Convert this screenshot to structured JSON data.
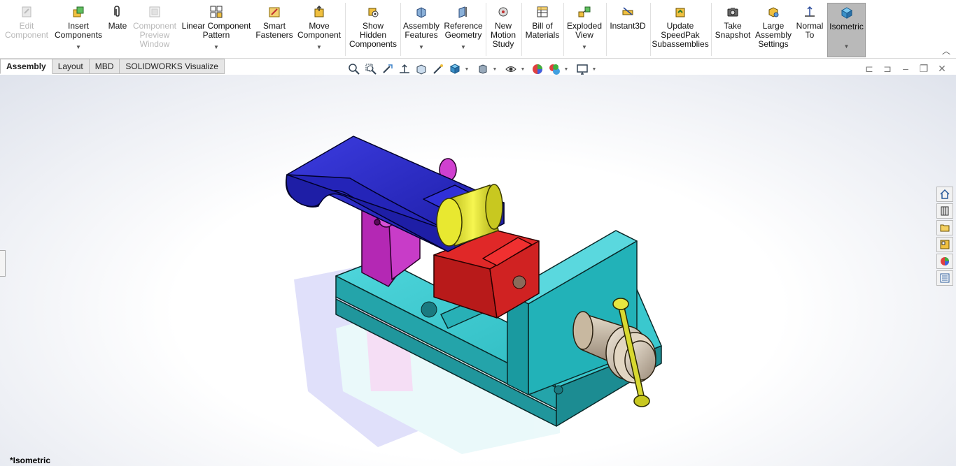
{
  "ribbon": {
    "buttons": [
      {
        "label": "Edit\nComponent",
        "icon": "edit-component-icon",
        "disabled": true
      },
      {
        "label": "Insert\nComponents",
        "icon": "insert-components-icon",
        "dropdown": true
      },
      {
        "label": "Mate",
        "icon": "mate-paperclip-icon"
      },
      {
        "label": "Component\nPreview\nWindow",
        "icon": "preview-window-icon",
        "disabled": true
      },
      {
        "label": "Linear Component\nPattern",
        "icon": "linear-pattern-icon",
        "dropdown": true
      },
      {
        "label": "Smart\nFasteners",
        "icon": "smart-fasteners-icon"
      },
      {
        "label": "Move\nComponent",
        "icon": "move-component-icon",
        "dropdown": true
      },
      {
        "label": "Show\nHidden\nComponents",
        "icon": "show-hidden-icon"
      },
      {
        "label": "Assembly\nFeatures",
        "icon": "assembly-features-icon",
        "dropdown": true
      },
      {
        "label": "Reference\nGeometry",
        "icon": "reference-geometry-icon",
        "dropdown": true
      },
      {
        "label": "New\nMotion\nStudy",
        "icon": "motion-study-icon"
      },
      {
        "label": "Bill of\nMaterials",
        "icon": "bill-of-materials-icon"
      },
      {
        "label": "Exploded\nView",
        "icon": "exploded-view-icon",
        "dropdown": true
      },
      {
        "label": "Instant3D",
        "icon": "instant3d-icon"
      },
      {
        "label": "Update\nSpeedPak\nSubassemblies",
        "icon": "speedpak-icon"
      },
      {
        "label": "Take\nSnapshot",
        "icon": "camera-icon"
      },
      {
        "label": "Large\nAssembly\nSettings",
        "icon": "large-assembly-icon"
      },
      {
        "label": "Normal\nTo",
        "icon": "normal-to-icon"
      },
      {
        "label": "Isometric",
        "icon": "isometric-cube-icon",
        "dropdown": true,
        "active": true
      }
    ]
  },
  "tabs": [
    "Assembly",
    "Layout",
    "MBD",
    "SOLIDWORKS Visualize"
  ],
  "active_tab": "Assembly",
  "view_name": "*Isometric",
  "colors": {
    "base": "#33c3c9",
    "arm": "#2a2acc",
    "bracket": "#b020b0",
    "roller": "#e6e62a",
    "jaw": "#c82020",
    "knob": "#d8c8b0"
  }
}
